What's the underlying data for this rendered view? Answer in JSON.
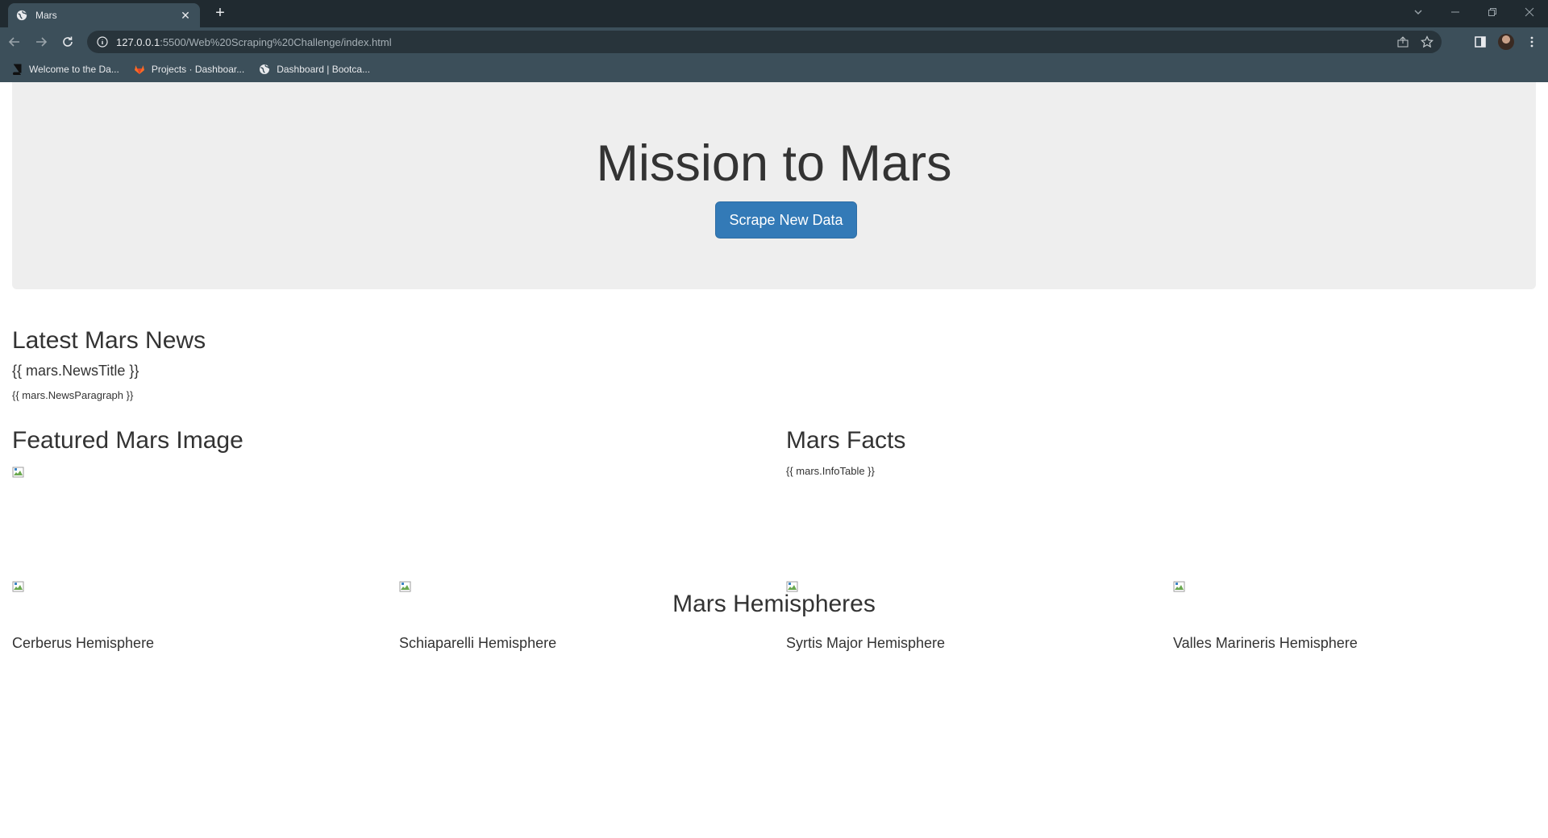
{
  "browser": {
    "tab_title": "Mars",
    "tab_close": "✕",
    "new_tab": "+",
    "url_host": "127.0.0.1",
    "url_path": ":5500/Web%20Scraping%20Challenge/index.html",
    "bookmarks": [
      {
        "label": "Welcome to the Da...",
        "icon": "book-icon"
      },
      {
        "label": "Projects · Dashboar...",
        "icon": "gitlab-icon"
      },
      {
        "label": "Dashboard | Bootca...",
        "icon": "globe-icon"
      }
    ]
  },
  "page": {
    "title": "Mission to Mars",
    "scrape_button": "Scrape New Data",
    "news": {
      "heading": "Latest Mars News",
      "title": "{{ mars.NewsTitle }}",
      "paragraph": "{{ mars.NewsParagraph }}"
    },
    "featured": {
      "heading": "Featured Mars Image"
    },
    "facts": {
      "heading": "Mars Facts",
      "table": "{{ mars.InfoTable }}"
    },
    "hemispheres": {
      "heading": "Mars Hemispheres",
      "items": [
        {
          "title": "Cerberus Hemisphere"
        },
        {
          "title": "Schiaparelli Hemisphere"
        },
        {
          "title": "Syrtis Major Hemisphere"
        },
        {
          "title": "Valles Marineris Hemisphere"
        }
      ]
    }
  },
  "colors": {
    "jumbotron_bg": "#eeeeee",
    "primary_button": "#337ab7",
    "chrome_dark": "#202a30",
    "chrome_toolbar": "#3c4f5a"
  }
}
